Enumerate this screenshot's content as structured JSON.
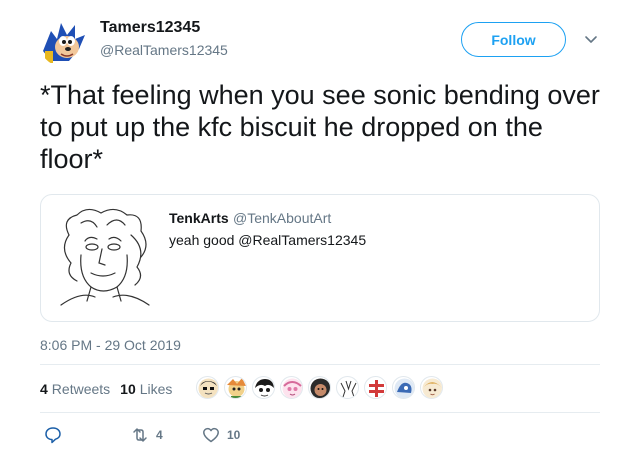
{
  "author": {
    "display_name": "Tamers12345",
    "handle": "@RealTamers12345",
    "avatar_icon": "sonic-avatar-icon"
  },
  "follow_label": "Follow",
  "tweet_text": "*That feeling when you see sonic bending over to put up the kfc biscuit he dropped on the floor*",
  "quote": {
    "display_name": "TenkArts",
    "handle": "@TenkAboutArt",
    "text": "yeah good @RealTamers12345",
    "image_icon": "sketch-drawing-icon"
  },
  "timestamp": "8:06 PM - 29 Oct 2019",
  "stats": {
    "retweets_count": "4",
    "retweets_label": "Retweets",
    "likes_count": "10",
    "likes_label": "Likes"
  },
  "likers": [
    "liker-avatar-1",
    "liker-avatar-2",
    "liker-avatar-3",
    "liker-avatar-4",
    "liker-avatar-5",
    "liker-avatar-6",
    "liker-avatar-7",
    "liker-avatar-8",
    "liker-avatar-9"
  ],
  "actions": {
    "reply_count": "",
    "retweet_count": "4",
    "like_count": "10"
  },
  "colors": {
    "accent": "#1da1f2",
    "secondary_text": "#657786",
    "border": "#e1e8ed"
  }
}
